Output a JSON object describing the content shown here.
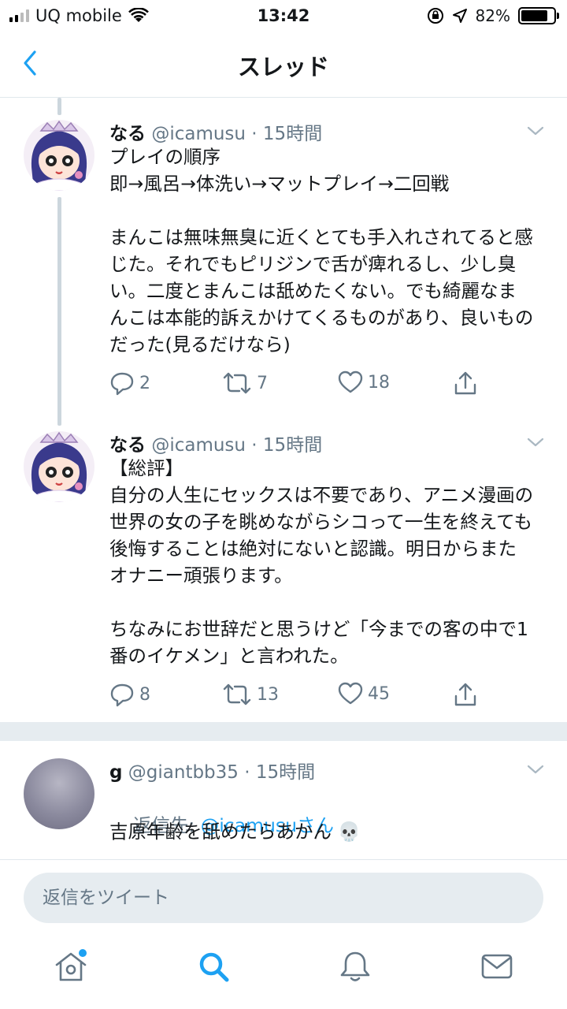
{
  "status_bar": {
    "carrier": "UQ mobile",
    "time": "13:42",
    "battery": "82%",
    "battery_level": 0.82
  },
  "nav": {
    "title": "スレッド",
    "back_icon": "chevron-left-icon"
  },
  "tweets": [
    {
      "name": "なる",
      "handle": "@icamusu",
      "time": "15時間",
      "text": "プレイの順序\n即→風呂→体洗い→マットプレイ→二回戦\n\nまんこは無味無臭に近くとても手入れされてると感じた。それでもピリジンで舌が痺れるし、少し臭い。二度とまんこは舐めたくない。でも綺麗なまんこは本能的訴えかけてくるものがあり、良いものだった(見るだけなら)",
      "replies": "2",
      "retweets": "7",
      "likes": "18"
    },
    {
      "name": "なる",
      "handle": "@icamusu",
      "time": "15時間",
      "text": "【総評】\n自分の人生にセックスは不要であり、アニメ漫画の世界の女の子を眺めながらシコって一生を終えても後悔することは絶対にないと認識。明日からまたオナニー頑張ります。\n\nちなみにお世辞だと思うけど「今までの客の中で1番のイケメン」と言われた。",
      "replies": "8",
      "retweets": "13",
      "likes": "45"
    },
    {
      "name": "g",
      "handle": "@giantbb35",
      "time": "15時間",
      "reply_prefix": "返信先: ",
      "reply_handle": "@icamusuさん",
      "text": "吉原年齢を舐めたらあかん 💀"
    }
  ],
  "meta_sep": " · ",
  "reply_bar": {
    "placeholder": "返信をツイート"
  },
  "tab_bar": {
    "items": [
      "home-icon",
      "search-icon",
      "notifications-icon",
      "messages-icon"
    ]
  },
  "colors": {
    "accent": "#1da1f2",
    "secondary_text": "#657786",
    "divider": "#e6ecf0"
  }
}
